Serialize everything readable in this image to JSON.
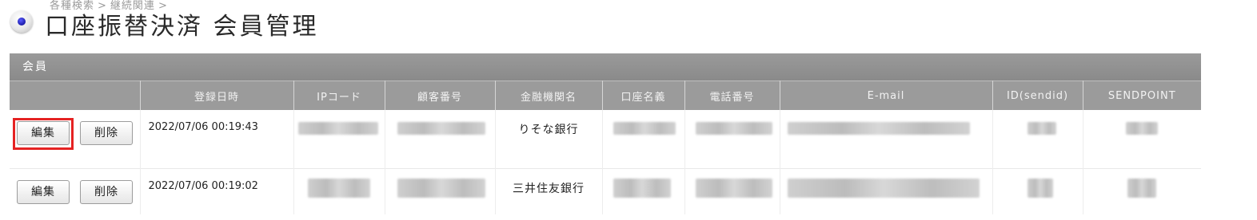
{
  "breadcrumb": [
    "各種検索",
    "継続関連"
  ],
  "page_title": "口座振替決済 会員管理",
  "panel": {
    "title": "会員",
    "columns": [
      "",
      "登録日時",
      "IPコード",
      "顧客番号",
      "金融機関名",
      "口座名義",
      "電話番号",
      "E-mail",
      "ID(sendid)",
      "SENDPOINT"
    ],
    "edit_label": "編集",
    "delete_label": "削除",
    "rows": [
      {
        "registered_at": "2022/07/06 00:19:43",
        "bank_name": "りそな銀行"
      },
      {
        "registered_at": "2022/07/06 00:19:02",
        "bank_name": "三井住友銀行"
      }
    ]
  },
  "colors": {
    "highlight": "#e52222",
    "header_bar": "#8f8f8f"
  },
  "icons": {
    "title": "radio-bullet-icon"
  }
}
